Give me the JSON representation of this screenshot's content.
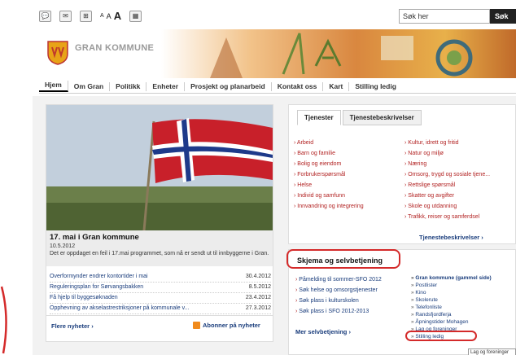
{
  "util": {
    "font_size_labels": [
      "A",
      "A",
      "A"
    ],
    "search_placeholder": "Søk her",
    "search_button": "Søk"
  },
  "brand": {
    "name": "GRAN KOMMUNE"
  },
  "nav": [
    "Hjem",
    "Om Gran",
    "Politikk",
    "Enheter",
    "Prosjekt og planarbeid",
    "Kontakt oss",
    "Kart",
    "Stilling ledig"
  ],
  "feature": {
    "title": "17. mai i Gran kommune",
    "date": "10.5.2012",
    "text": "Det er oppdaget en feil i 17.mai programmet, som nå er sendt ut til innbyggerne i Gran."
  },
  "news": [
    {
      "title": "Overformynder endrer kontortider i mai",
      "date": "30.4.2012"
    },
    {
      "title": "Reguleringsplan for Sørvangsbakken",
      "date": "8.5.2012"
    },
    {
      "title": "Få hjelp til byggesøknaden",
      "date": "23.4.2012"
    },
    {
      "title": "Opphevning av akselastrestriksjoner på kommunale v...",
      "date": "27.3.2012"
    }
  ],
  "news_footer": {
    "more": "Flere nyheter",
    "rss": "Abonner på nyheter"
  },
  "services": {
    "tabs": [
      "Tjenester",
      "Tjenestebeskrivelser"
    ],
    "left": [
      "Arbeid",
      "Barn og familie",
      "Bolig og eiendom",
      "Forbrukerspørsmål",
      "Helse",
      "Individ og samfunn",
      "Innvandring og integrering"
    ],
    "right": [
      "Kultur, idrett og fritid",
      "Natur og miljø",
      "Næring",
      "Omsorg, trygd og sosiale tjene...",
      "Rettslige spørsmål",
      "Skatter og avgifter",
      "Skole og utdanning",
      "Trafikk, reiser og samferdsel"
    ],
    "more": "Tjenestebeskrivelser"
  },
  "selfservice": {
    "title": "Skjema og selvbetjening",
    "items": [
      "Påmelding til sommer-SFO 2012",
      "Søk helse og omsorgstjenester",
      "Søk plass i kulturskolen",
      "Søk plass i SFO 2012-2013"
    ],
    "more": "Mer selvbetjening",
    "links": [
      "Gran kommune (gammel side)",
      "Postlister",
      "Kino",
      "Skolerute",
      "Telefonliste",
      "Randsfjordferja",
      "Åpningstider Mohagen",
      "Lag og foreninger",
      "Stilling ledig"
    ],
    "tooltip": "Lag og foreninger"
  },
  "colors": {
    "accent_red": "#d42a2a",
    "link_blue": "#1a3d7c",
    "service_red": "#b22222"
  }
}
